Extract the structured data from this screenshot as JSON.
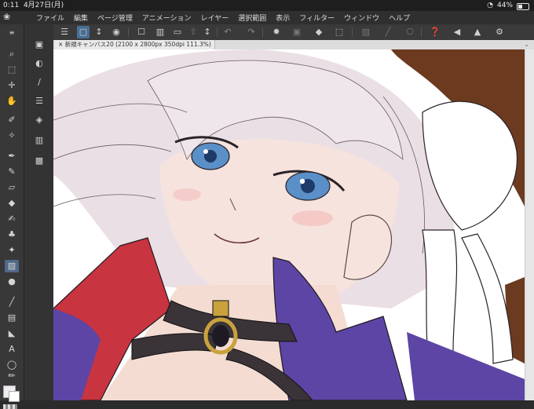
{
  "status": {
    "time": "0:11",
    "date": "4月27日(月)",
    "battery": "44%",
    "battery_level": 0.44
  },
  "menu": {
    "items": [
      "ファイル",
      "編集",
      "ページ管理",
      "アニメーション",
      "レイヤー",
      "選択範囲",
      "表示",
      "フィルター",
      "ウィンドウ",
      "ヘルプ"
    ]
  },
  "command_icons": [
    "menu-icon",
    "canvas-size-icon",
    "updown-icon",
    "snapshot-icon",
    "new-page-icon",
    "open-icon",
    "save-icon",
    "export-icon",
    "updown2-icon",
    "undo-icon",
    "redo-icon",
    "loading-icon",
    "clear-icon",
    "fill-icon",
    "transform-icon",
    "hide-selection-icon",
    "snap-icon",
    "edit-icon",
    "help-icon",
    "flip-horizontal-icon",
    "flip-vertical-icon",
    "settings-icon"
  ],
  "canvas": {
    "tab_title": "新規キャンバス20 (2100 x 2800px 350dpi 111.3%)"
  },
  "colors": {
    "hair": "#ebdfe6",
    "skin": "#f7e3dd",
    "eye": "#5a8fc7",
    "collar_red": "#c8343f",
    "coat_purple": "#5d45a6",
    "choker": "#3a3438",
    "gold": "#c9a23e",
    "horn": "#6b3a1f"
  }
}
